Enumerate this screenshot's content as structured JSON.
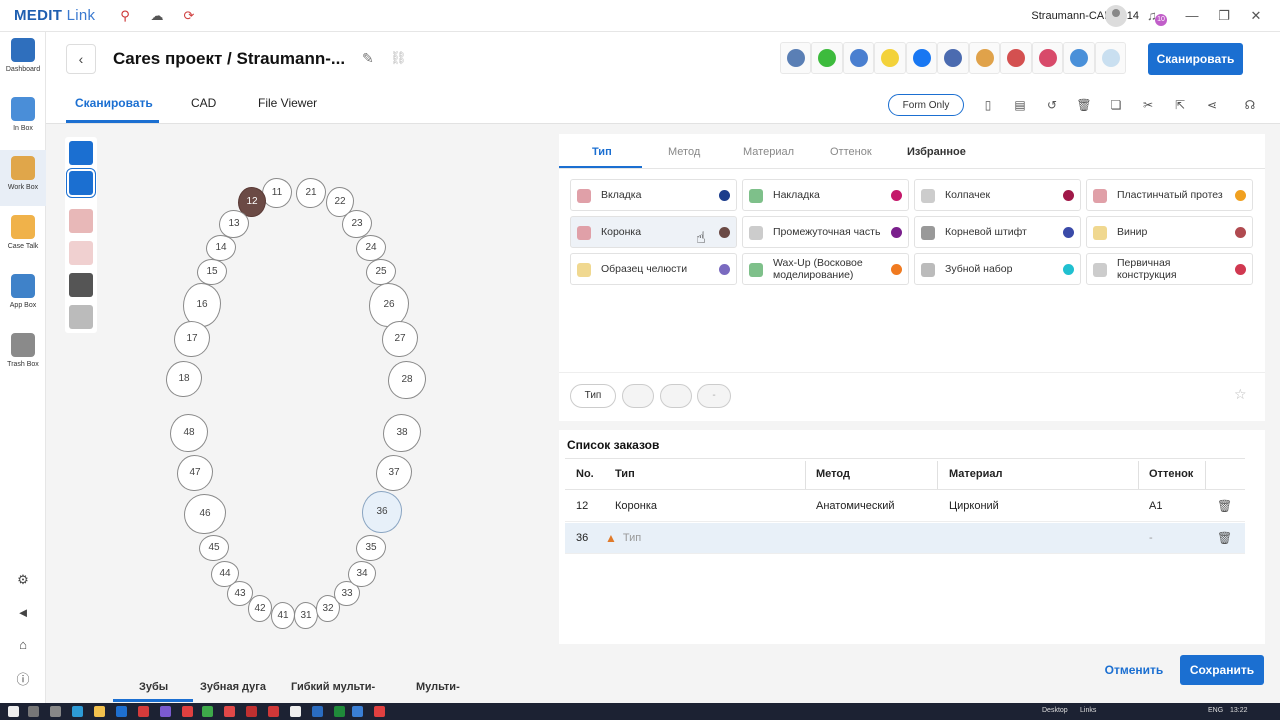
{
  "titlebar": {
    "logo_main": "MEDIT",
    "logo_sub": "Link",
    "user_name": "Straumann-CARES14",
    "notification_count": "10"
  },
  "sidebar": {
    "items": [
      {
        "label": "Dashboard",
        "color": "#2f6fbd"
      },
      {
        "label": "In Box",
        "color": "#4a8ed8"
      },
      {
        "label": "Work Box",
        "color": "#e0a64a"
      },
      {
        "label": "Case Talk",
        "color": "#f0b24a"
      },
      {
        "label": "App Box",
        "color": "#3f82c9"
      },
      {
        "label": "Trash Box",
        "color": "#8a8a8a"
      }
    ]
  },
  "header": {
    "back_icon": "chevron-left-icon",
    "title": "Cares проект / Straumann-...",
    "scan_button": "Сканировать",
    "tabs": [
      {
        "label": "Сканировать",
        "active": true
      },
      {
        "label": "CAD",
        "active": false
      },
      {
        "label": "File Viewer",
        "active": false
      }
    ],
    "form_only": "Form Only",
    "app_icon_colors": [
      "#5a7fb5",
      "#3dbb3d",
      "#4a7fd0",
      "#f3d23a",
      "#1877f2",
      "#4b6bb0",
      "#e0a24a",
      "#d45050",
      "#d84a6a",
      "#4a90d9",
      "#c9dff0"
    ]
  },
  "teeth": {
    "upper": [
      "11",
      "12",
      "13",
      "14",
      "15",
      "16",
      "17",
      "18",
      "21",
      "22",
      "23",
      "24",
      "25",
      "26",
      "27",
      "28"
    ],
    "lower": [
      "31",
      "32",
      "33",
      "34",
      "35",
      "36",
      "37",
      "38",
      "41",
      "42",
      "43",
      "44",
      "45",
      "46",
      "47",
      "48"
    ],
    "selected": "12",
    "marked": "36"
  },
  "bottom_tabs": [
    "Зубы",
    "Зубная дуга",
    "Гибкий мульти-",
    "Мульти-"
  ],
  "sub_tabs": [
    {
      "label": "Тип",
      "active": true
    },
    {
      "label": "Метод",
      "active": false
    },
    {
      "label": "Материал",
      "active": false
    },
    {
      "label": "Оттенок",
      "active": false
    },
    {
      "label": "Избранное",
      "active": false
    }
  ],
  "types": [
    {
      "label": "Вкладка",
      "color": "#1c3d8c",
      "icon_color": "#e0a0a8"
    },
    {
      "label": "Накладка",
      "color": "#c4186a",
      "icon_color": "#7ec08a"
    },
    {
      "label": "Колпачек",
      "color": "#a01848",
      "icon_color": "#cccccc"
    },
    {
      "label": "Пластинчатый протез",
      "color": "#f0a020",
      "icon_color": "#e0a0a8"
    },
    {
      "label": "Коронка",
      "color": "#6b4a45",
      "icon_color": "#e0a0a8"
    },
    {
      "label": "Промежуточная часть",
      "color": "#7a1f8c",
      "icon_color": "#cccccc"
    },
    {
      "label": "Корневой штифт",
      "color": "#3a4aa8",
      "icon_color": "#999999"
    },
    {
      "label": "Винир",
      "color": "#b04a50",
      "icon_color": "#f0d890"
    },
    {
      "label": "Образец челюсти",
      "color": "#7a6ac0",
      "icon_color": "#f0d890"
    },
    {
      "label": "Wax-Up (Восковое моделирование)",
      "color": "#f07a20",
      "icon_color": "#7ec08a"
    },
    {
      "label": "Зубной набор",
      "color": "#20c0d0",
      "icon_color": "#bbbbbb"
    },
    {
      "label": "Первичная конструкция",
      "color": "#d03850",
      "icon_color": "#cccccc"
    }
  ],
  "filter_chips": [
    "Тип",
    "",
    "",
    "-"
  ],
  "order_list": {
    "title": "Список заказов",
    "columns": [
      "No.",
      "Тип",
      "Метод",
      "Материал",
      "Оттенок"
    ],
    "rows": [
      {
        "no": "12",
        "type": "Коронка",
        "method": "Анатомический",
        "material": "Цирконий",
        "shade": "A1"
      },
      {
        "no": "36",
        "type": "Тип",
        "method": "",
        "material": "",
        "shade": "-"
      }
    ]
  },
  "footer": {
    "cancel": "Отменить",
    "save": "Сохранить"
  },
  "taskbar": {
    "desktop": "Desktop",
    "links": "Links",
    "lang": "ENG",
    "time": "13:22"
  }
}
